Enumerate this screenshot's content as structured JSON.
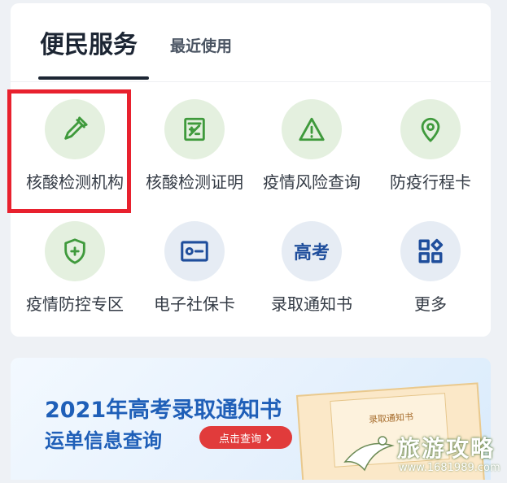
{
  "tabs": {
    "active": "便民服务",
    "recent": "最近使用"
  },
  "services": [
    {
      "label": "核酸检测机构",
      "icon": "dropper-icon",
      "theme": "green"
    },
    {
      "label": "核酸检测证明",
      "icon": "certificate-icon",
      "theme": "green"
    },
    {
      "label": "疫情风险查询",
      "icon": "warning-icon",
      "theme": "green"
    },
    {
      "label": "防疫行程卡",
      "icon": "location-pin-icon",
      "theme": "green"
    },
    {
      "label": "疫情防控专区",
      "icon": "shield-plus-icon",
      "theme": "green"
    },
    {
      "label": "电子社保卡",
      "icon": "id-card-icon",
      "theme": "blue"
    },
    {
      "label": "录取通知书",
      "icon": "gaokao-icon",
      "icon_text": "高考",
      "theme": "blue"
    },
    {
      "label": "更多",
      "icon": "grid-icon",
      "theme": "blue"
    }
  ],
  "banner": {
    "title": "2021年高考录取通知书",
    "subtitle": "运单信息查询",
    "button": "点击查询",
    "letter_label": "录取通知书"
  },
  "watermark": {
    "text": "旅游攻略",
    "url": "www.1681989.com"
  },
  "colors": {
    "green_icon": "#3f9a3c",
    "blue_icon": "#1f4e9c",
    "highlight": "#e8212e",
    "banner_text": "#1f5fb8"
  }
}
